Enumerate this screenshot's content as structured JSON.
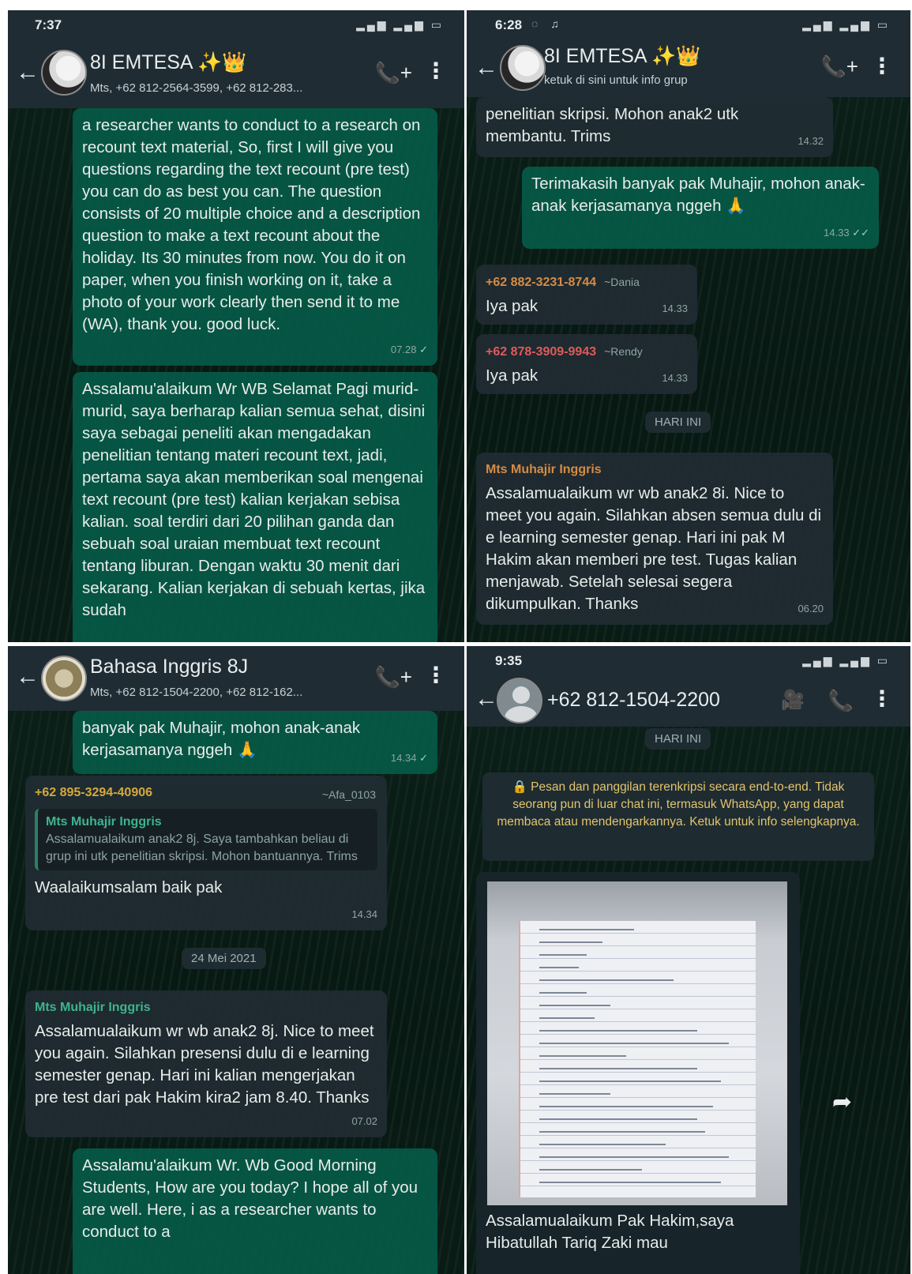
{
  "p1": {
    "time": "7:37",
    "title": "8I EMTESA ✨👑",
    "subtitle": "Mts, +62 812-2564-3599, +62 812-283...",
    "msg1": {
      "text": "a researcher wants to conduct to a research on recount text material, So, first I will give you questions regarding the text recount (pre test) you can do as best you can. The question consists of 20 multiple choice and a description question to make a text recount about the holiday. Its 30 minutes from now. You do it on paper, when you finish working on it, take a photo of your work clearly then send it to me (WA), thank you. good luck.",
      "time": "07.28",
      "tick": "✓"
    },
    "msg2": {
      "text": "Assalamu'alaikum Wr WB Selamat Pagi murid-murid, saya berharap kalian semua sehat, disini saya sebagai peneliti akan mengadakan penelitian tentang materi recount text, jadi, pertama saya akan memberikan soal mengenai text recount (pre test) kalian kerjakan sebisa kalian. soal terdiri dari 20 pilihan ganda dan sebuah soal uraian membuat text recount tentang liburan. Dengan waktu 30 menit dari sekarang. Kalian kerjakan di sebuah kertas, jika sudah"
    }
  },
  "p2": {
    "time": "6:28",
    "title": "8I EMTESA ✨👑",
    "subtitle": "ketuk di sini untuk info grup",
    "msg1": {
      "text": "penelitian skripsi. Mohon anak2 utk membantu. Trims",
      "time": "14.32"
    },
    "msg2": {
      "text": "Terimakasih banyak pak Muhajir, mohon anak-anak kerjasamanya nggeh 🙏",
      "time": "14.33",
      "tick": "✓✓"
    },
    "msg3": {
      "sender": "+62 882-3231-8744",
      "alias": "~Dania",
      "text": "Iya pak",
      "time": "14.33"
    },
    "msg4": {
      "sender": "+62 878-3909-9943",
      "alias": "~Rendy",
      "text": "Iya pak",
      "time": "14.33"
    },
    "date_chip": "HARI INI",
    "msg5": {
      "sender": "Mts Muhajir Inggris",
      "text": "Assalamualaikum wr wb anak2 8i. Nice to meet you again. Silahkan absen semua dulu di e learning semester genap. Hari ini pak M Hakim akan memberi pre test. Tugas kalian  menjawab. Setelah selesai segera dikumpulkan. Thanks",
      "time": "06.20"
    }
  },
  "p3": {
    "title": "Bahasa Inggris 8J",
    "subtitle": "Mts, +62 812-1504-2200, +62 812-162...",
    "msg1": {
      "text": "banyak pak Muhajir, mohon anak-anak kerjasamanya nggeh 🙏",
      "time": "14.34",
      "tick": "✓"
    },
    "msg2": {
      "sender": "+62 895-3294-40906",
      "alias": "~Afa_0103",
      "quote_name": "Mts Muhajir Inggris",
      "quote_text": "Assalamualaikum anak2 8j. Saya tambahkan beliau di grup ini utk penelitian skripsi. Mohon bantuannya. Trims",
      "text": "Waalaikumsalam baik pak",
      "time": "14.34"
    },
    "date_chip": "24 Mei 2021",
    "msg3": {
      "sender": "Mts Muhajir Inggris",
      "text": "Assalamualaikum wr wb anak2 8j. Nice to meet you again. Silahkan presensi dulu di e learning semester genap. Hari ini kalian mengerjakan pre test dari pak Hakim kira2 jam 8.40. Thanks",
      "time": "07.02"
    },
    "msg4": {
      "text": "Assalamu'alaikum Wr. Wb Good Morning Students, How are you today? I hope all of you are well. Here, i as a researcher wants to conduct to a"
    }
  },
  "p4": {
    "time": "9:35",
    "title": "+62 812-1504-2200",
    "date_chip": "HARI INI",
    "encryption": "🔒 Pesan dan panggilan terenkripsi secara end-to-end. Tidak seorang pun di luar chat ini, termasuk WhatsApp, yang dapat membaca atau mendengarkannya. Ketuk untuk info selengkapnya.",
    "caption": "Assalamualaikum Pak Hakim,saya Hibatullah Tariq Zaki mau"
  },
  "icons": {
    "back": "←",
    "call_add": "📞+",
    "menu": "⋮",
    "video": "🎥",
    "call": "📞",
    "forward": "➦"
  },
  "colors": {
    "appbar": "#1f2c33",
    "outgoing": "#065a48",
    "incoming": "#202c33",
    "sender_orange": "#d68b45",
    "sender_red": "#e05a5a"
  }
}
